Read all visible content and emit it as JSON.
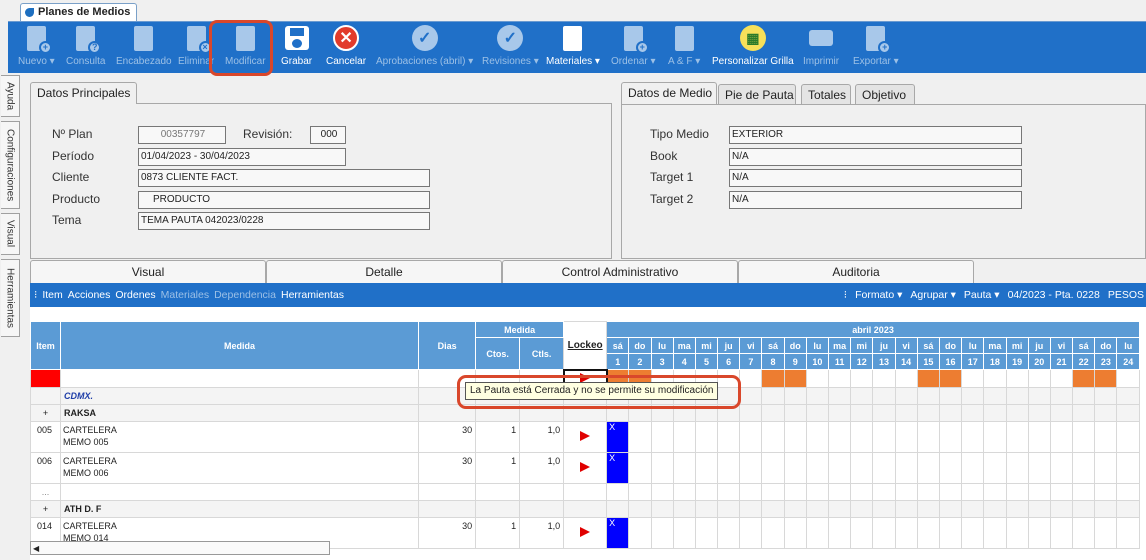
{
  "window_tab": {
    "title": "Planes de Medios"
  },
  "toolbar": {
    "items": [
      {
        "label": "Nuevo ▾",
        "icon": "new-doc-icon",
        "enabled": false
      },
      {
        "label": "Consulta",
        "icon": "query-doc-icon",
        "enabled": false
      },
      {
        "label": "Encabezado",
        "icon": "header-edit-icon",
        "enabled": false
      },
      {
        "label": "Eliminar",
        "icon": "delete-doc-icon",
        "enabled": false
      },
      {
        "label": "Modificar",
        "icon": "modify-doc-icon",
        "enabled": false
      },
      {
        "label": "Grabar",
        "icon": "save-icon",
        "enabled": true
      },
      {
        "label": "Cancelar",
        "icon": "cancel-icon",
        "enabled": true
      },
      {
        "label": "Aprobaciones (abril) ▾",
        "icon": "approval-icon",
        "enabled": false
      },
      {
        "label": "Revisiones ▾",
        "icon": "review-icon",
        "enabled": false
      },
      {
        "label": "Materiales ▾",
        "icon": "materials-icon",
        "enabled": true
      },
      {
        "label": "Ordenar ▾",
        "icon": "order-icon",
        "enabled": false
      },
      {
        "label": "A & F ▾",
        "icon": "af-icon",
        "enabled": false
      },
      {
        "label": "Personalizar Grilla",
        "icon": "grid-customize-icon",
        "enabled": true
      },
      {
        "label": "Imprimir",
        "icon": "print-icon",
        "enabled": false
      },
      {
        "label": "Exportar ▾",
        "icon": "export-icon",
        "enabled": false
      }
    ]
  },
  "side_tabs": [
    "Ayuda",
    "Configuraciones",
    "Visual",
    "Herramientas"
  ],
  "datos_principales": {
    "tab": "Datos Principales",
    "plan_label": "Nº Plan",
    "plan_value": "00357797",
    "revision_label": "Revisión:",
    "revision_value": "000",
    "periodo_label": "Período",
    "periodo_value": "01/04/2023 - 30/04/2023",
    "cliente_label": "Cliente",
    "cliente_value": "0873 CLIENTE FACT.",
    "producto_label": "Producto",
    "producto_value": "PRODUCTO",
    "tema_label": "Tema",
    "tema_value": "TEMA PAUTA 042023/0228"
  },
  "datos_medio": {
    "tabs": [
      "Datos de Medio",
      "Pie de Pauta",
      "Totales",
      "Objetivo"
    ],
    "tipo_label": "Tipo Medio",
    "tipo_value": "EXTERIOR",
    "book_label": "Book",
    "book_value": "N/A",
    "target1_label": "Target 1",
    "target1_value": "N/A",
    "target2_label": "Target 2",
    "target2_value": "N/A"
  },
  "bottom_tabs": [
    "Visual",
    "Detalle",
    "Control Administrativo",
    "Auditoria"
  ],
  "grid_menu": {
    "left": [
      "Item",
      "Acciones",
      "Ordenes",
      "Materiales",
      "Dependencia",
      "Herramientas"
    ],
    "left_enabled": [
      true,
      true,
      true,
      false,
      false,
      true
    ],
    "right": [
      "Formato ▾",
      "Agrupar ▾",
      "Pauta ▾",
      "04/2023 - Pta. 0228",
      "PESOS"
    ]
  },
  "grid": {
    "headers": {
      "item": "Item",
      "medida": "Medida",
      "dias": "Dias",
      "medida_group": "Medida",
      "ctos": "Ctos.",
      "ctls": "Ctls.",
      "lockeo": "Lockeo",
      "month": "abril 2023"
    },
    "weekdays": [
      "sá",
      "do",
      "lu",
      "ma",
      "mi",
      "ju",
      "vi",
      "sá",
      "do",
      "lu",
      "ma",
      "mi",
      "ju",
      "vi",
      "sá",
      "do",
      "lu",
      "ma",
      "mi",
      "ju",
      "vi",
      "sá",
      "do",
      "lu"
    ],
    "days": [
      "1",
      "2",
      "3",
      "4",
      "5",
      "6",
      "7",
      "8",
      "9",
      "10",
      "11",
      "12",
      "13",
      "14",
      "15",
      "16",
      "17",
      "18",
      "19",
      "20",
      "21",
      "22",
      "23",
      "24"
    ],
    "weekend_days": [
      1,
      2,
      8,
      9,
      15,
      16,
      22,
      23
    ],
    "rows": [
      {
        "type": "top"
      },
      {
        "type": "group",
        "toggle": "",
        "name": "CDMX."
      },
      {
        "type": "group",
        "toggle": "+",
        "name": "RAKSA"
      },
      {
        "type": "item",
        "item": "005",
        "line1": "CARTELERA",
        "line2": "MEMO 005",
        "dias": "30",
        "ctos": "1",
        "ctls": "1,0",
        "mark": "X"
      },
      {
        "type": "item",
        "item": "006",
        "line1": "CARTELERA",
        "line2": "MEMO 006",
        "dias": "30",
        "ctos": "1",
        "ctls": "1,0",
        "mark": "X"
      },
      {
        "type": "spacer",
        "item": "..."
      },
      {
        "type": "group",
        "toggle": "+",
        "name": "ATH D. F"
      },
      {
        "type": "item",
        "item": "014",
        "line1": "CARTELERA",
        "line2": "MEMO 014",
        "dias": "30",
        "ctos": "1",
        "ctls": "1,0",
        "mark": "X"
      }
    ]
  },
  "tooltip": {
    "text": "La Pauta está Cerrada y no se permite su modificación"
  }
}
